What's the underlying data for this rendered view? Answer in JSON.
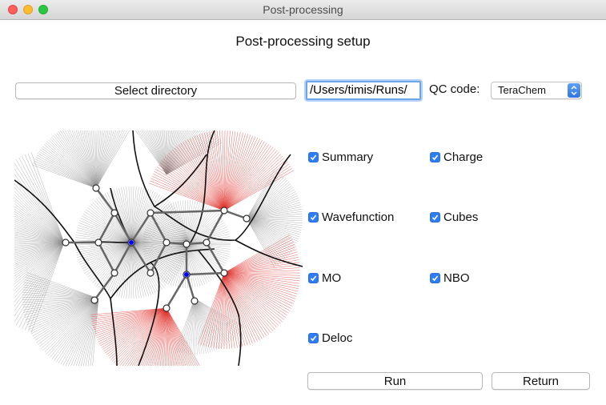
{
  "window": {
    "title": "Post-processing"
  },
  "heading": "Post-processing setup",
  "directory": {
    "button_label": "Select directory",
    "path_value": "/Users/timis/Runs/"
  },
  "qc_code": {
    "label": "QC code:",
    "selected": "TeraChem"
  },
  "options": [
    {
      "label": "Summary",
      "checked": true
    },
    {
      "label": "Charge",
      "checked": true
    },
    {
      "label": "Wavefunction",
      "checked": true
    },
    {
      "label": "Cubes",
      "checked": true
    },
    {
      "label": "MO",
      "checked": true
    },
    {
      "label": "NBO",
      "checked": true
    },
    {
      "label": "Deloc",
      "checked": true
    }
  ],
  "actions": {
    "run_label": "Run",
    "return_label": "Return"
  },
  "colors": {
    "accent": "#2e7cf6",
    "plot_gray": "#8a8a8a",
    "plot_red": "#e0302a",
    "plot_black": "#111111",
    "critical_point": "#0000ff"
  }
}
